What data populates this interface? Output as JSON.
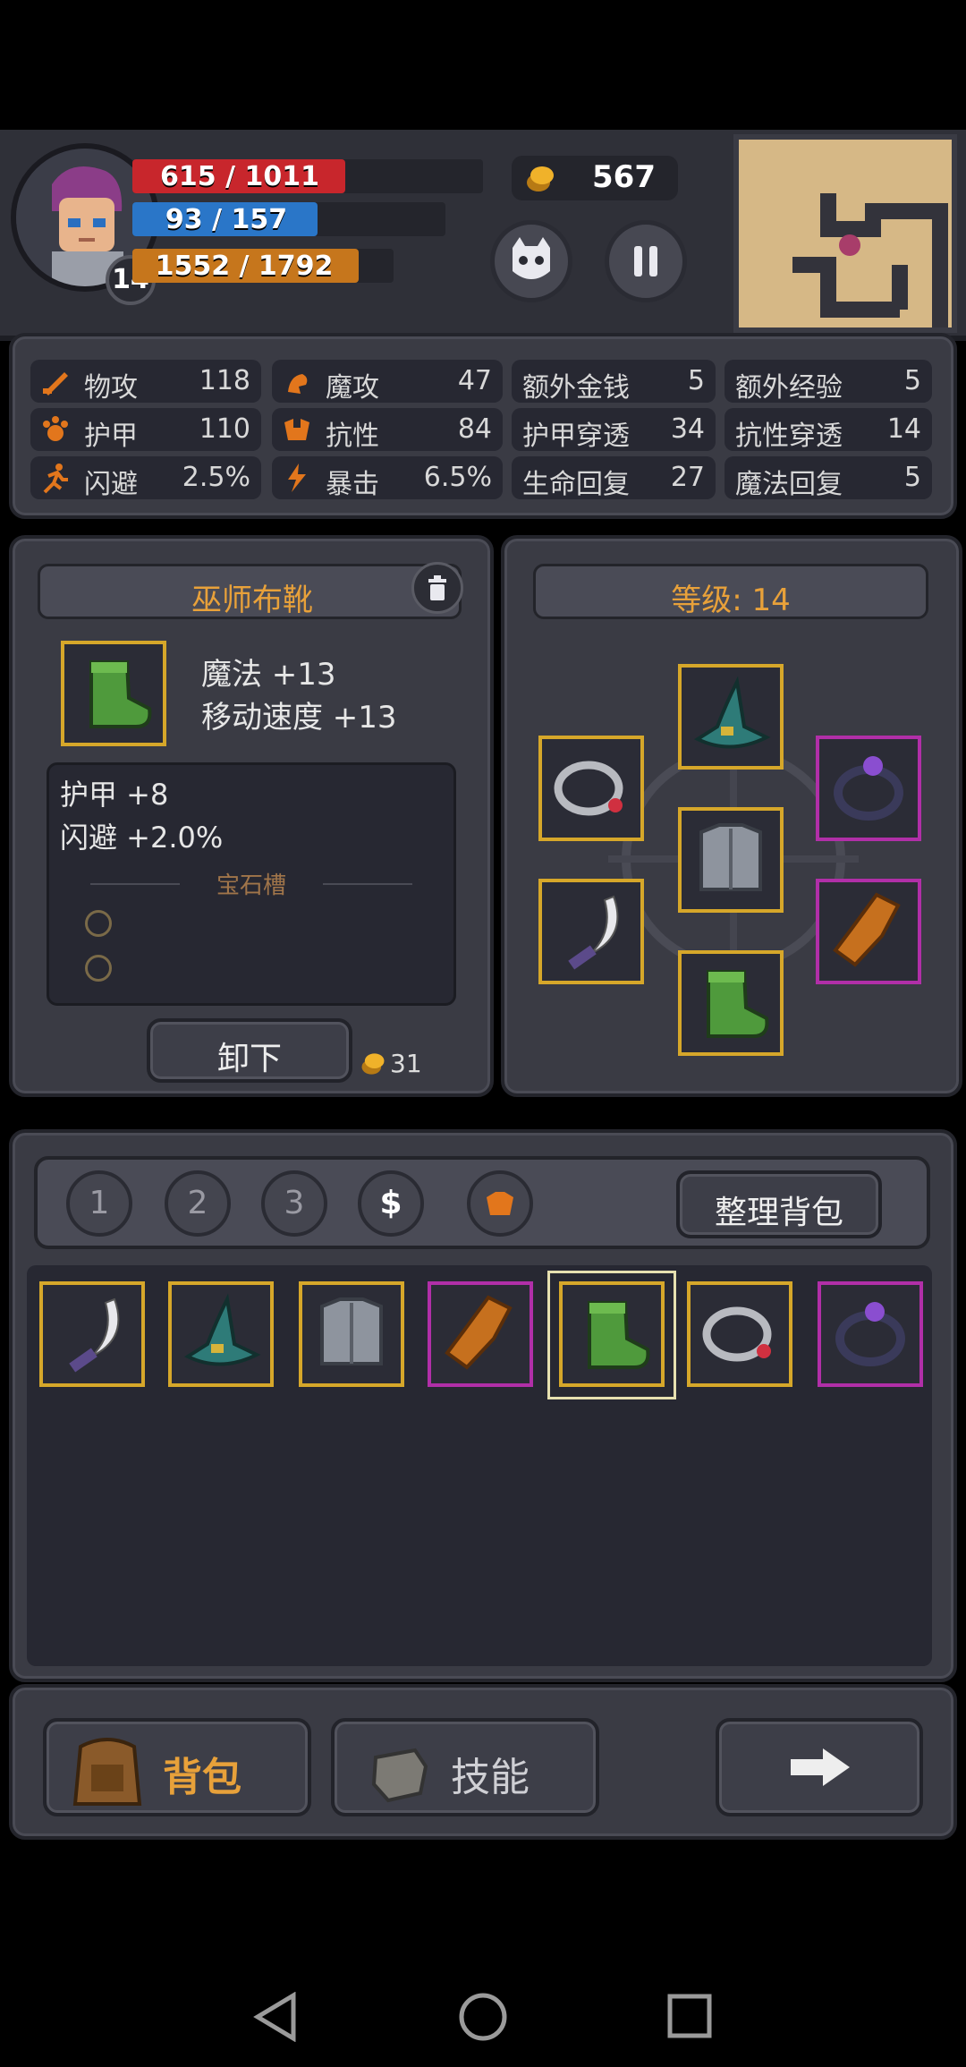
{
  "hud": {
    "hp_text": "615 / 1011",
    "hp_fraction": 0.608,
    "mp_text": "93 / 157",
    "mp_fraction": 0.592,
    "xp_text": "1552 / 1792",
    "xp_fraction": 0.866,
    "level": "14",
    "gold": "567"
  },
  "stats": [
    {
      "label": "物攻",
      "value": "118",
      "icon": "sword-icon"
    },
    {
      "label": "魔攻",
      "value": "47",
      "icon": "magic-hand-icon"
    },
    {
      "label": "额外金钱",
      "value": "5"
    },
    {
      "label": "额外经验",
      "value": "5"
    },
    {
      "label": "护甲",
      "value": "110",
      "icon": "paw-armor-icon"
    },
    {
      "label": "抗性",
      "value": "84",
      "icon": "resist-icon"
    },
    {
      "label": "护甲穿透",
      "value": "34"
    },
    {
      "label": "抗性穿透",
      "value": "14"
    },
    {
      "label": "闪避",
      "value": "2.5%",
      "icon": "running-man-icon"
    },
    {
      "label": "暴击",
      "value": "6.5%",
      "icon": "lightning-icon"
    },
    {
      "label": "生命回复",
      "value": "27"
    },
    {
      "label": "魔法回复",
      "value": "5"
    }
  ],
  "item_detail": {
    "name": "巫师布靴",
    "main_stats": [
      "魔法 +13",
      "移动速度 +13"
    ],
    "sub_stats": [
      "护甲 +8",
      "闪避 +2.0%"
    ],
    "gem_slot_label": "宝石槽",
    "unequip_label": "卸下",
    "sell_price": "31"
  },
  "equipment": {
    "level_label": "等级: 14"
  },
  "bag": {
    "tabs": [
      "1",
      "2",
      "3"
    ],
    "sort_label": "整理背包",
    "items": [
      "dagger-icon",
      "wizard-hat-icon",
      "chest-armor-icon",
      "gauntlet-icon",
      "boots-icon",
      "silver-ring-icon",
      "purple-ring-icon"
    ]
  },
  "bottom_nav": {
    "backpack_label": "背包",
    "skills_label": "技能"
  },
  "colors": {
    "hp": "#c8262c",
    "mp": "#2a76c8",
    "xp": "#c6761c",
    "accent": "#e8a13a",
    "legendary": "#d6a72a",
    "epic": "#b12fa8"
  }
}
